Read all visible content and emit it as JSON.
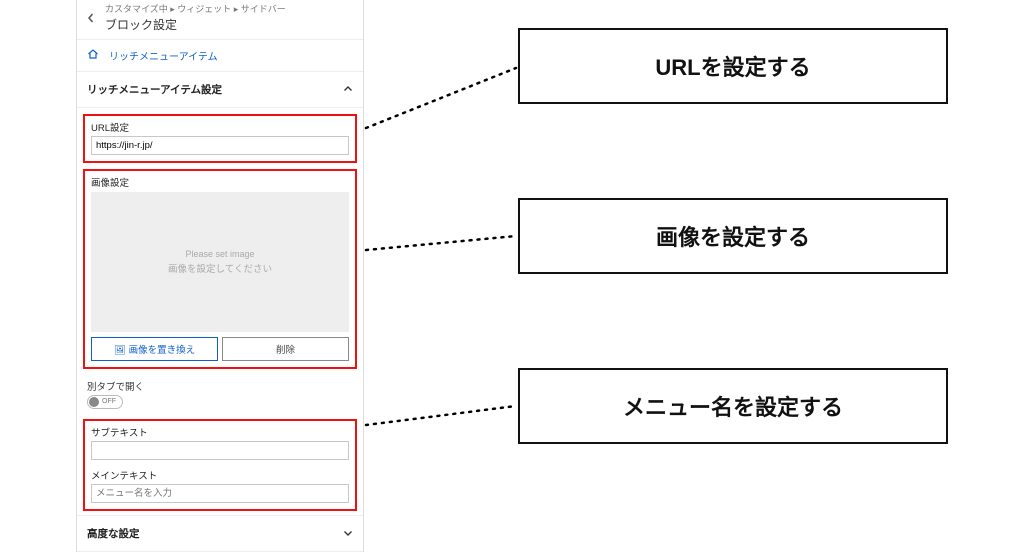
{
  "header": {
    "breadcrumbs": "カスタマイズ中 ▸ ウィジェット ▸ サイドバー",
    "title": "ブロック設定"
  },
  "home_link": "リッチメニューアイテム",
  "section_toggle": "リッチメニューアイテム設定",
  "url_section": {
    "label": "URL設定",
    "value": "https://jin-r.jp/"
  },
  "image_section": {
    "label": "画像設定",
    "placeholder_line1": "Please set image",
    "placeholder_line2": "画像を設定してください",
    "replace_btn": "🖼 画像を置き換え",
    "delete_btn": "削除"
  },
  "newtab": {
    "label": "別タブで開く",
    "value": "OFF"
  },
  "text_section": {
    "sub_label": "サブテキスト",
    "sub_value": "",
    "main_label": "メインテキスト",
    "main_placeholder": "メニュー名を入力"
  },
  "advanced_toggle": "高度な設定",
  "callouts": {
    "url": "URLを設定する",
    "image": "画像を設定する",
    "menu": "メニュー名を設定する"
  }
}
